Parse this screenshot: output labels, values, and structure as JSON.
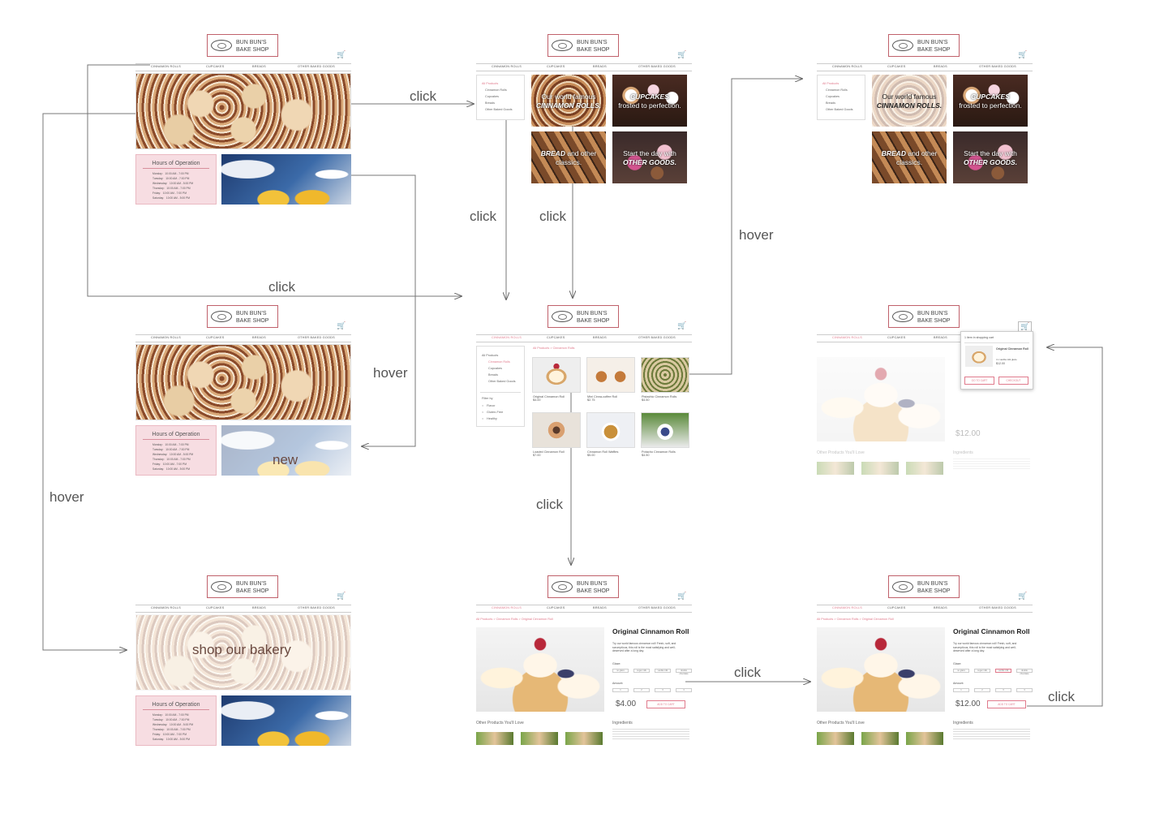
{
  "logo_text": "BUN BUN'S\nBAKE SHOP",
  "nav": [
    "CINNAMON ROLLS",
    "CUPCAKES",
    "BREADS",
    "OTHER BAKED GOODS"
  ],
  "hours": {
    "title": "Hours of Operation",
    "rows": [
      {
        "day": "Monday:",
        "time": "10:00 AM - 7:00 PM"
      },
      {
        "day": "Tuesday:",
        "time": "10:00 AM - 7:00 PM"
      },
      {
        "day": "Wednesday:",
        "time": "10:00 AM - 5:00 PM"
      },
      {
        "day": "Thursday:",
        "time": "10:00 AM - 7:00 PM"
      },
      {
        "day": "Friday:",
        "time": "10:00 AM - 7:00 PM"
      },
      {
        "day": "Saturday:",
        "time": "10:00 AM - 5:00 PM"
      }
    ]
  },
  "hover_texts": {
    "new": "new",
    "shop": "shop our bakery"
  },
  "sidebar": [
    "All Products",
    "Cinnamon Rolls",
    "Cupcakes",
    "Breads",
    "Other Baked Goods"
  ],
  "filter": {
    "title": "Filter by",
    "options": [
      "Flavor",
      "Gluten-Free",
      "Healthy"
    ]
  },
  "tiles": [
    {
      "lead": "Our world famous",
      "strong": "CINNAMON ROLLS."
    },
    {
      "strong": "CUPCAKES",
      "lead": "frosted to perfection."
    },
    {
      "strong": "BREAD",
      "lead": "and other classics."
    },
    {
      "lead": "Start the day with",
      "strong": "OTHER GOODS."
    }
  ],
  "breadcrumb_list": "All Products > Cinnamon Rolls",
  "breadcrumb_detail": "All Products > Cinnamon Rolls > Original Cinnamon Roll",
  "products": [
    {
      "name": "Original Cinnamon Roll",
      "price": "$4.00"
    },
    {
      "name": "Mini Cinna-coffee Roll",
      "price": "$2.75"
    },
    {
      "name": "Pistachio Cinnamon Rolls",
      "price": "$4.50"
    },
    {
      "name": "Loaded Cinnamon Roll",
      "price": "$7.00"
    },
    {
      "name": "Cinnamon Roll Waffles",
      "price": "$5.00"
    },
    {
      "name": "Potacho Cinnamon Rolls",
      "price": "$4.50"
    }
  ],
  "detail": {
    "title": "Original Cinnamon Roll",
    "desc": "Try our world famous cinnamon roll! Fresh, soft, and scrumptious, this roll is the most satisfying and well-deserved after a long day.",
    "glaze_label": "Glaze:",
    "glaze_opts": [
      "no glaze",
      "sugar milk",
      "vanilla milk",
      "double chocolate"
    ],
    "amount_label": "Amount:",
    "amount_opts": [
      "1",
      "2",
      "3",
      "4"
    ],
    "price1": "$4.00",
    "price2": "$12.00",
    "add": "ADD TO CART",
    "other": "Other Products You'll Love",
    "ingredients": "Ingredients"
  },
  "cart_popup": {
    "title": "1 item in shopping cart",
    "item": "Original Cinnamon Roll",
    "note": "4 x vanilla milk glaze",
    "price": "$12.00",
    "add": "GO TO CART",
    "checkout": "CHECKOUT"
  },
  "flow_labels": {
    "click": "click",
    "hover": "hover"
  }
}
